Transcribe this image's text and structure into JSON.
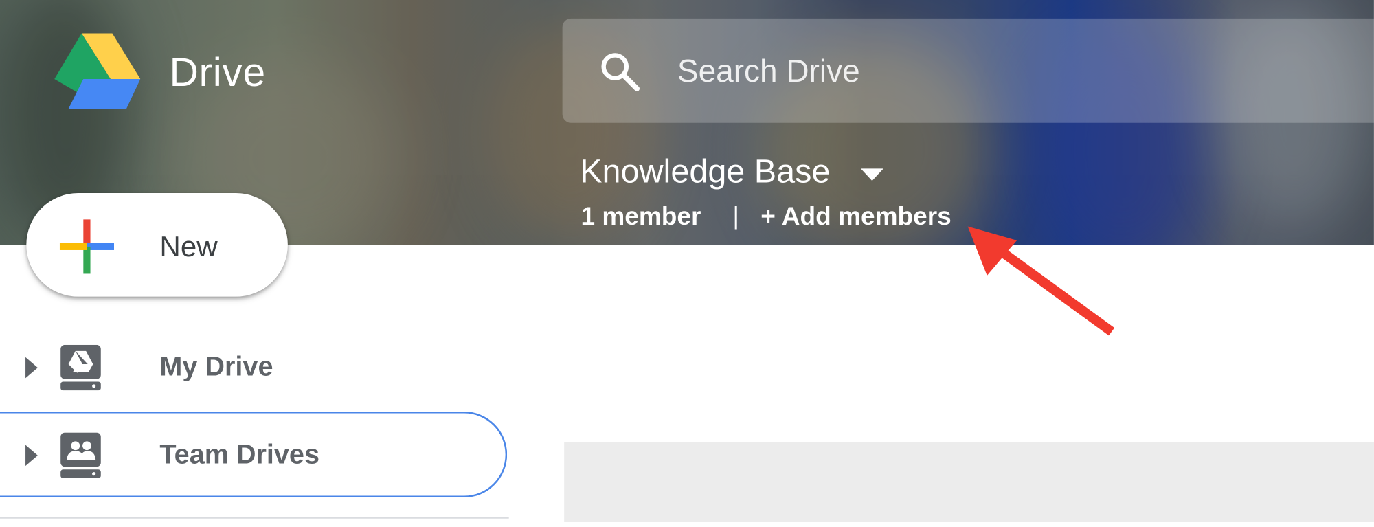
{
  "app": {
    "title": "Drive",
    "logo_icon": "google-drive-logo-icon"
  },
  "search": {
    "icon": "search-icon",
    "placeholder": "Search Drive"
  },
  "team_drive": {
    "name": "Knowledge Base",
    "dropdown_icon": "caret-down-icon",
    "member_count": "1 member",
    "separator": "|",
    "add_members_label": "+ Add members"
  },
  "new_button": {
    "label": "New",
    "icon": "plus-icon"
  },
  "sidebar": {
    "items": [
      {
        "label": "My Drive",
        "icon": "my-drive-icon",
        "expand_icon": "arrow-right-icon",
        "selected": false
      },
      {
        "label": "Team Drives",
        "icon": "team-drives-icon",
        "expand_icon": "arrow-right-icon",
        "selected": true
      }
    ]
  },
  "colors": {
    "accent": "#4a86e8",
    "annotation_arrow": "#f23a2e",
    "drive_green": "#1fa463",
    "drive_yellow": "#ffd04b",
    "drive_blue": "#4688f4"
  },
  "annotation": {
    "icon": "red-arrow-icon",
    "target": "add-members-link"
  }
}
